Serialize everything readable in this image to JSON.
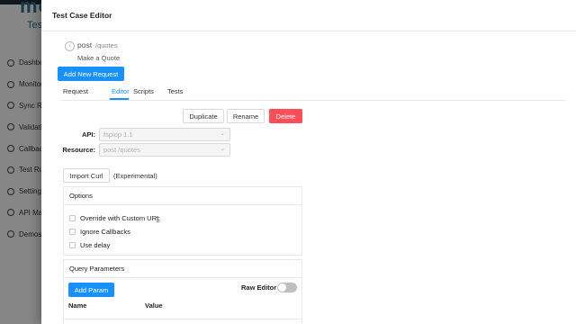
{
  "background": {
    "logo": "mo",
    "subtitle": "Test",
    "menu": [
      {
        "label": "Dashbo",
        "icon": "dashboard-icon"
      },
      {
        "label": "Monitor",
        "icon": "monitor-icon"
      },
      {
        "label": "Sync Re",
        "icon": "sync-icon"
      },
      {
        "label": "Validati",
        "icon": "validation-icon"
      },
      {
        "label": "Callbac",
        "icon": "callback-icon"
      },
      {
        "label": "Test Ru",
        "icon": "test-runner-icon"
      },
      {
        "label": "Setting",
        "icon": "settings-icon"
      },
      {
        "label": "API Ma",
        "icon": "api-management-icon"
      },
      {
        "label": "Demos",
        "icon": "demos-icon"
      }
    ]
  },
  "drawer": {
    "title": "Test Case Editor"
  },
  "request": {
    "method": "post",
    "path": "/quotes",
    "description": "Make a Quote",
    "icon": "chevron-right-circle-icon"
  },
  "buttons": {
    "add_new_request": "Add New Request",
    "duplicate": "Duplicate",
    "rename": "Rename",
    "delete": "Delete",
    "import_curl": "Import Curl",
    "add_param": "Add Param"
  },
  "tabs": [
    {
      "label": "Request",
      "active": false
    },
    {
      "label": "Editor",
      "active": true
    },
    {
      "label": "Scripts",
      "active": false
    },
    {
      "label": "Tests",
      "active": false
    }
  ],
  "form": {
    "api_label": "API:",
    "api_value": "fspiop 1.1",
    "resource_label": "Resource:",
    "resource_value": "post /quotes",
    "experimental": "(Experimental)"
  },
  "options": {
    "title": "Options",
    "items": [
      {
        "label": "Override with Custom URL",
        "checked": false
      },
      {
        "label": "Ignore Callbacks",
        "checked": false
      },
      {
        "label": "Use delay",
        "checked": false
      }
    ]
  },
  "query_params": {
    "title": "Query Parameters",
    "raw_editor_label": "Raw Editor",
    "raw_editor_on": false,
    "columns": [
      "Name",
      "Value"
    ]
  },
  "colors": {
    "primary": "#1890ff",
    "danger": "#ff4d5a",
    "overlay": "rgba(0,0,0,0.45)"
  }
}
